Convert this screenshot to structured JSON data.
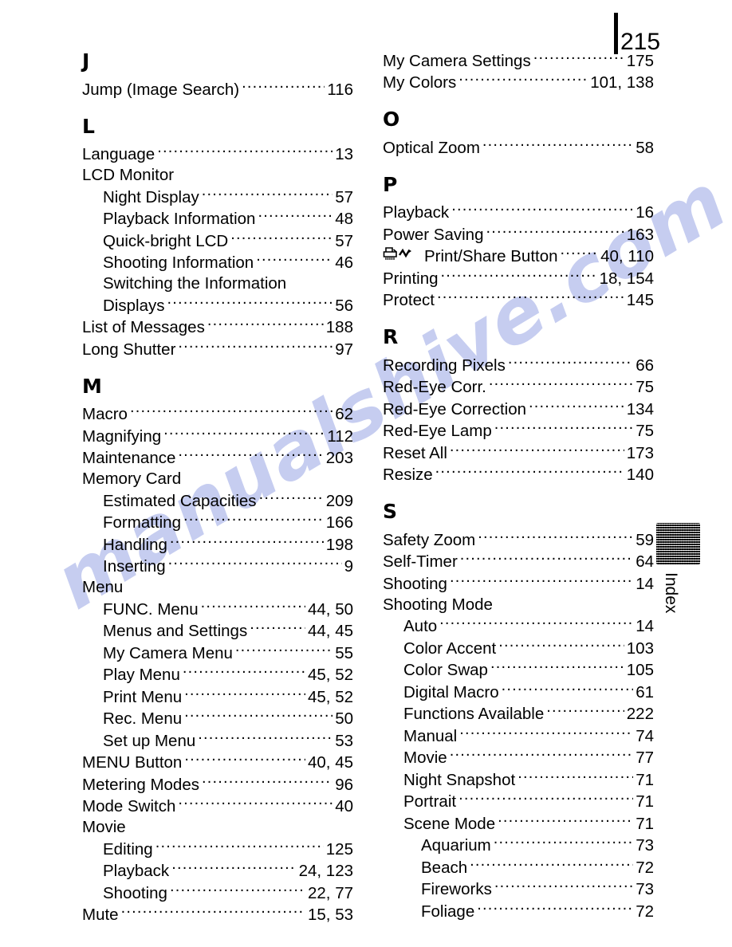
{
  "page": {
    "number": "215",
    "side_tab_label": "Index",
    "watermark_text": "manualshive.com",
    "watermark_color": "#c6cdf0"
  },
  "columns": [
    {
      "name": "left",
      "sections": [
        {
          "letter": "J",
          "entries": [
            {
              "label": "Jump (Image Search)",
              "page": "116",
              "indent": 0
            }
          ]
        },
        {
          "letter": "L",
          "entries": [
            {
              "label": "Language",
              "page": "13",
              "indent": 0
            },
            {
              "label": "LCD Monitor",
              "page": "",
              "indent": 0,
              "leader": false
            },
            {
              "label": "Night Display",
              "page": "57",
              "indent": 1
            },
            {
              "label": "Playback Information",
              "page": "48",
              "indent": 1
            },
            {
              "label": "Quick-bright LCD",
              "page": "57",
              "indent": 1
            },
            {
              "label": "Shooting Information",
              "page": "46",
              "indent": 1
            },
            {
              "label": "Switching the Information",
              "page": "",
              "indent": 1,
              "leader": false
            },
            {
              "label": "Displays",
              "page": "56",
              "indent": 1
            },
            {
              "label": "List of Messages",
              "page": "188",
              "indent": 0
            },
            {
              "label": "Long Shutter",
              "page": "97",
              "indent": 0
            }
          ]
        },
        {
          "letter": "M",
          "entries": [
            {
              "label": "Macro",
              "page": "62",
              "indent": 0
            },
            {
              "label": "Magnifying",
              "page": "112",
              "indent": 0
            },
            {
              "label": "Maintenance",
              "page": "203",
              "indent": 0
            },
            {
              "label": "Memory Card",
              "page": "",
              "indent": 0,
              "leader": false
            },
            {
              "label": "Estimated Capacities",
              "page": "209",
              "indent": 1
            },
            {
              "label": "Formatting",
              "page": "166",
              "indent": 1
            },
            {
              "label": "Handling",
              "page": "198",
              "indent": 1
            },
            {
              "label": "Inserting",
              "page": "9",
              "indent": 1
            },
            {
              "label": "Menu",
              "page": "",
              "indent": 0,
              "leader": false
            },
            {
              "label": "FUNC. Menu",
              "page": "44, 50",
              "indent": 1
            },
            {
              "label": "Menus and Settings",
              "page": "44, 45",
              "indent": 1
            },
            {
              "label": "My Camera Menu",
              "page": "55",
              "indent": 1
            },
            {
              "label": "Play Menu",
              "page": "45, 52",
              "indent": 1
            },
            {
              "label": "Print Menu",
              "page": "45, 52",
              "indent": 1
            },
            {
              "label": "Rec. Menu",
              "page": "50",
              "indent": 1
            },
            {
              "label": "Set up Menu",
              "page": "53",
              "indent": 1
            },
            {
              "label": "MENU Button",
              "page": "40, 45",
              "indent": 0
            },
            {
              "label": "Metering Modes",
              "page": "96",
              "indent": 0
            },
            {
              "label": "Mode Switch",
              "page": "40",
              "indent": 0
            },
            {
              "label": "Movie",
              "page": "",
              "indent": 0,
              "leader": false
            },
            {
              "label": "Editing",
              "page": "125",
              "indent": 1
            },
            {
              "label": "Playback",
              "page": "24, 123",
              "indent": 1
            },
            {
              "label": "Shooting",
              "page": "22, 77",
              "indent": 1
            },
            {
              "label": "Mute",
              "page": "15, 53",
              "indent": 0
            }
          ]
        }
      ]
    },
    {
      "name": "right",
      "sections": [
        {
          "letter": "",
          "entries": [
            {
              "label": "My Camera Settings",
              "page": "175",
              "indent": 0
            },
            {
              "label": "My Colors",
              "page": "101, 138",
              "indent": 0
            }
          ]
        },
        {
          "letter": "O",
          "entries": [
            {
              "label": "Optical Zoom",
              "page": "58",
              "indent": 0
            }
          ]
        },
        {
          "letter": "P",
          "entries": [
            {
              "label": "Playback",
              "page": "16",
              "indent": 0
            },
            {
              "label": "Power Saving",
              "page": "163",
              "indent": 0
            },
            {
              "label": "Print/Share Button",
              "page": "40, 110",
              "indent": 0,
              "icon": "print-share-icon"
            },
            {
              "label": "Printing",
              "page": "18, 154",
              "indent": 0
            },
            {
              "label": "Protect",
              "page": "145",
              "indent": 0
            }
          ]
        },
        {
          "letter": "R",
          "entries": [
            {
              "label": "Recording Pixels",
              "page": "66",
              "indent": 0
            },
            {
              "label": "Red-Eye Corr.",
              "page": "75",
              "indent": 0
            },
            {
              "label": "Red-Eye Correction",
              "page": "134",
              "indent": 0
            },
            {
              "label": "Red-Eye Lamp",
              "page": "75",
              "indent": 0
            },
            {
              "label": "Reset All",
              "page": "173",
              "indent": 0
            },
            {
              "label": "Resize",
              "page": "140",
              "indent": 0
            }
          ]
        },
        {
          "letter": "S",
          "entries": [
            {
              "label": "Safety Zoom",
              "page": "59",
              "indent": 0
            },
            {
              "label": "Self-Timer",
              "page": "64",
              "indent": 0
            },
            {
              "label": "Shooting",
              "page": "14",
              "indent": 0
            },
            {
              "label": "Shooting Mode",
              "page": "",
              "indent": 0,
              "leader": false
            },
            {
              "label": "Auto",
              "page": "14",
              "indent": 1
            },
            {
              "label": "Color Accent",
              "page": "103",
              "indent": 1
            },
            {
              "label": "Color Swap",
              "page": "105",
              "indent": 1
            },
            {
              "label": "Digital Macro",
              "page": "61",
              "indent": 1
            },
            {
              "label": "Functions Available",
              "page": "222",
              "indent": 1
            },
            {
              "label": "Manual",
              "page": "74",
              "indent": 1
            },
            {
              "label": "Movie",
              "page": "77",
              "indent": 1
            },
            {
              "label": "Night Snapshot",
              "page": "71",
              "indent": 1
            },
            {
              "label": "Portrait",
              "page": "71",
              "indent": 1
            },
            {
              "label": "Scene Mode",
              "page": "71",
              "indent": 1
            },
            {
              "label": "Aquarium",
              "page": "73",
              "indent": 2
            },
            {
              "label": "Beach",
              "page": "72",
              "indent": 2
            },
            {
              "label": "Fireworks",
              "page": "73",
              "indent": 2
            },
            {
              "label": "Foliage",
              "page": "72",
              "indent": 2
            }
          ]
        }
      ]
    }
  ]
}
